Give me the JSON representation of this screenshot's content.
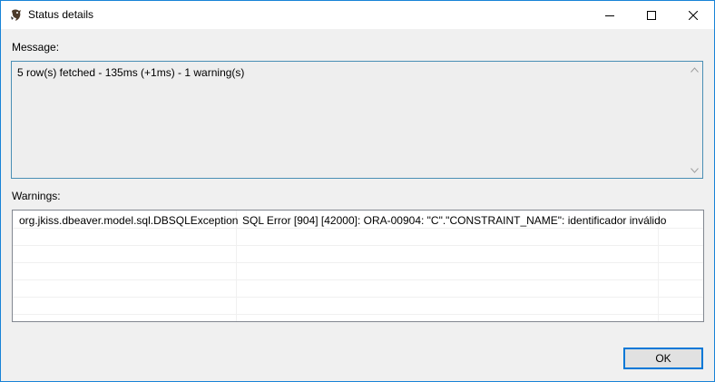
{
  "window": {
    "title": "Status details"
  },
  "message": {
    "label": "Message:",
    "text": "5 row(s) fetched - 135ms (+1ms) - 1 warning(s)"
  },
  "warnings": {
    "label": "Warnings:",
    "rows": [
      {
        "type": "org.jkiss.dbeaver.model.sql.DBSQLException",
        "detail": "SQL Error [904] [42000]: ORA-00904: \"C\".\"CONSTRAINT_NAME\": identificador inválido"
      }
    ]
  },
  "buttons": {
    "ok": "OK"
  },
  "colors": {
    "window_border": "#1883d7",
    "dialog_bg": "#f0f0f0",
    "message_border": "#4a8fb5",
    "button_accent": "#0078d7"
  },
  "icons": {
    "app": "dbeaver-beaver-icon",
    "minimize": "minimize-icon",
    "maximize": "maximize-icon",
    "close": "close-icon"
  }
}
